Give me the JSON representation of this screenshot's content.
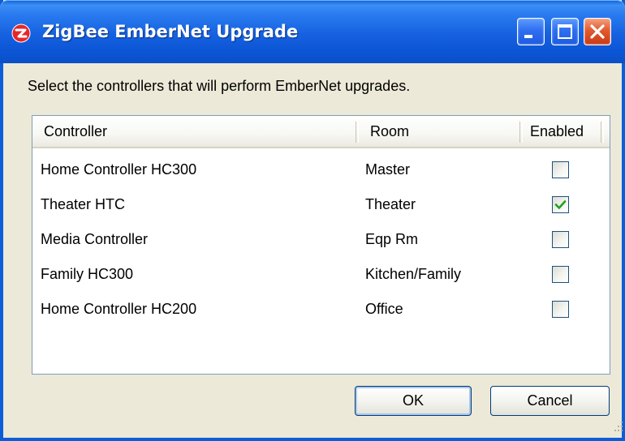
{
  "window": {
    "title": "ZigBee EmberNet Upgrade",
    "icon": "zigbee-logo-icon",
    "controls": [
      "minimize-icon",
      "maximize-icon",
      "close-icon"
    ],
    "accent_color": "#0a5fd8"
  },
  "instruction": "Select the controllers that will perform EmberNet upgrades.",
  "table": {
    "columns": {
      "controller": "Controller",
      "room": "Room",
      "enabled": "Enabled"
    },
    "rows": [
      {
        "controller": "Home Controller HC300",
        "room": "Master",
        "enabled": false
      },
      {
        "controller": "Theater HTC",
        "room": "Theater",
        "enabled": true
      },
      {
        "controller": "Media Controller",
        "room": "Eqp Rm",
        "enabled": false
      },
      {
        "controller": "Family HC300",
        "room": "Kitchen/Family",
        "enabled": false
      },
      {
        "controller": "Home Controller HC200",
        "room": "Office",
        "enabled": false
      }
    ]
  },
  "buttons": {
    "ok": "OK",
    "cancel": "Cancel"
  }
}
